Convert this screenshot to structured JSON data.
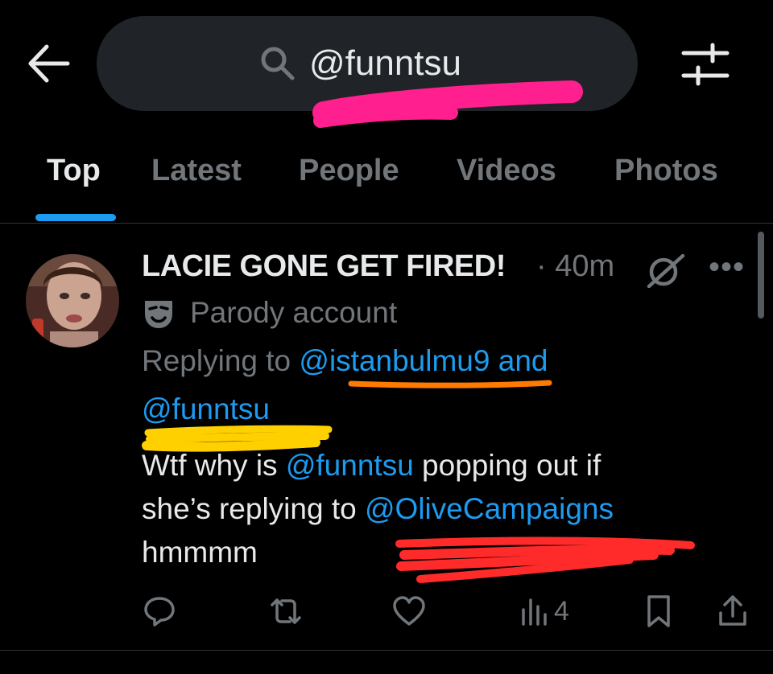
{
  "header": {
    "back_icon": "arrow-left-icon",
    "search_icon": "search-icon",
    "search_query": "@funntsu",
    "filter_icon": "sliders-icon"
  },
  "tabs": [
    {
      "label": "Top",
      "active": true
    },
    {
      "label": "Latest",
      "active": false
    },
    {
      "label": "People",
      "active": false
    },
    {
      "label": "Videos",
      "active": false
    },
    {
      "label": "Photos",
      "active": false
    }
  ],
  "tweet": {
    "display_name": "LACIE GONE GET FIRED!",
    "time": "· 40m",
    "badge_label": "Parody account",
    "replying_prefix": "Replying to ",
    "replying_user1": "@istanbulmu9",
    "replying_and": " and",
    "replying_user2": "@funntsu",
    "body_line1_pre": "Wtf why is ",
    "body_line1_mention": "@funntsu",
    "body_line1_post": " popping out if",
    "body_line2_pre": "she’s replying to ",
    "body_line2_mention": "@OliveCampaigns",
    "body_line3": "hmmmm",
    "more_label": "•••",
    "views": "4"
  },
  "colors": {
    "background": "#000000",
    "accent": "#1d9bf0",
    "muted": "#71767b",
    "text": "#e7e9ea",
    "highlight_pink": "#ff1f8e",
    "highlight_orange": "#ff7a00",
    "highlight_yellow": "#ffd000",
    "highlight_red": "#ff2a2a"
  }
}
